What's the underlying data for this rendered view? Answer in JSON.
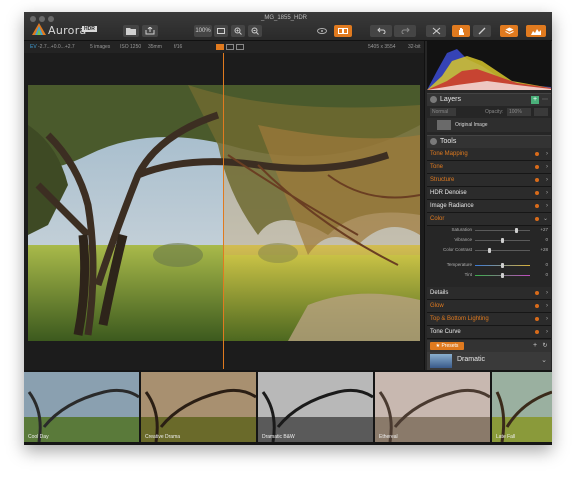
{
  "window": {
    "title": "_MG_1855_HDR"
  },
  "app": {
    "name": "Aurora",
    "badge": "HDR"
  },
  "toolbar": {
    "zoom_label": "100%"
  },
  "info": {
    "ev_label": "EV",
    "ev_values": "-2.7...+0.0...+2.7",
    "images": "5 images",
    "iso": "ISO 1250",
    "focal": "35mm",
    "aperture": "f/16",
    "dimensions": "5405 x 3554",
    "bitdepth": "32-bit"
  },
  "panels": {
    "layers": {
      "title": "Layers",
      "blend_mode": "Normal",
      "opacity_label": "Opacity:",
      "opacity_value": "100%",
      "layer_name": "Original Image"
    },
    "tools": {
      "title": "Tools"
    }
  },
  "tools": [
    {
      "label": "Tone Mapping",
      "color": "#e07a1f"
    },
    {
      "label": "Tone",
      "color": "#e07a1f"
    },
    {
      "label": "Structure",
      "color": "#e07a1f"
    },
    {
      "label": "HDR Denoise",
      "color": "#e8e8e8"
    },
    {
      "label": "Image Radiance",
      "color": "#e8e8e8"
    },
    {
      "label": "Color",
      "color": "#e07a1f"
    }
  ],
  "color_sliders": [
    {
      "label": "Saturation",
      "value": "+27",
      "pos": 0.75
    },
    {
      "label": "Vibrance",
      "value": "0",
      "pos": 0.5
    },
    {
      "label": "Color Contrast",
      "value": "+28",
      "pos": 0.26
    },
    {
      "label": "Temperature",
      "value": "0",
      "pos": 0.5
    },
    {
      "label": "Tint",
      "value": "0",
      "pos": 0.5
    }
  ],
  "tools2": [
    {
      "label": "Details",
      "color": "#e8e8e8"
    },
    {
      "label": "Glow",
      "color": "#e07a1f"
    },
    {
      "label": "Top & Bottom Lighting",
      "color": "#e07a1f"
    },
    {
      "label": "Tone Curve",
      "color": "#e8e8e8"
    }
  ],
  "presets": {
    "button_label": "Presets",
    "current": "Dramatic"
  },
  "filmstrip": [
    {
      "label": "Cool Day"
    },
    {
      "label": "Creative Drama"
    },
    {
      "label": "Dramatic B&W"
    },
    {
      "label": "Ethereal"
    },
    {
      "label": "Late Fall"
    }
  ],
  "colors": {
    "accent": "#e07a1f",
    "panel_bg": "#262626",
    "window_bg": "#1c1c1c"
  }
}
